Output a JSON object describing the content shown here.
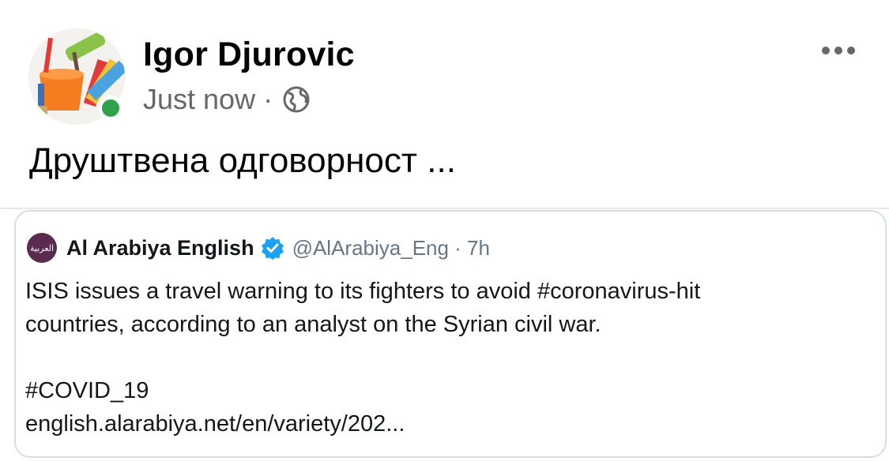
{
  "post": {
    "author": "Igor Djurovic",
    "timestamp": "Just now",
    "separator": "·",
    "privacy_icon": "globe-icon",
    "more_icon": "more-options-icon",
    "text": "Друштвена одговорност ..."
  },
  "tweet": {
    "author_name": "Al Arabiya English",
    "avatar_text": "العربية",
    "verified_icon": "verified-badge-icon",
    "handle_time": "@AlArabiya_Eng · 7h",
    "line1": "ISIS issues a travel warning to its fighters to avoid #coronavirus-hit",
    "line2": "countries, according to an analyst on the Syrian civil war.",
    "hashtag": "#COVID_19",
    "link": "english.alarabiya.net/en/variety/202..."
  },
  "colors": {
    "online": "#31a24c",
    "secondary_text": "#65676b",
    "verified_blue": "#1da1f2",
    "card_border": "#d9dde1"
  }
}
